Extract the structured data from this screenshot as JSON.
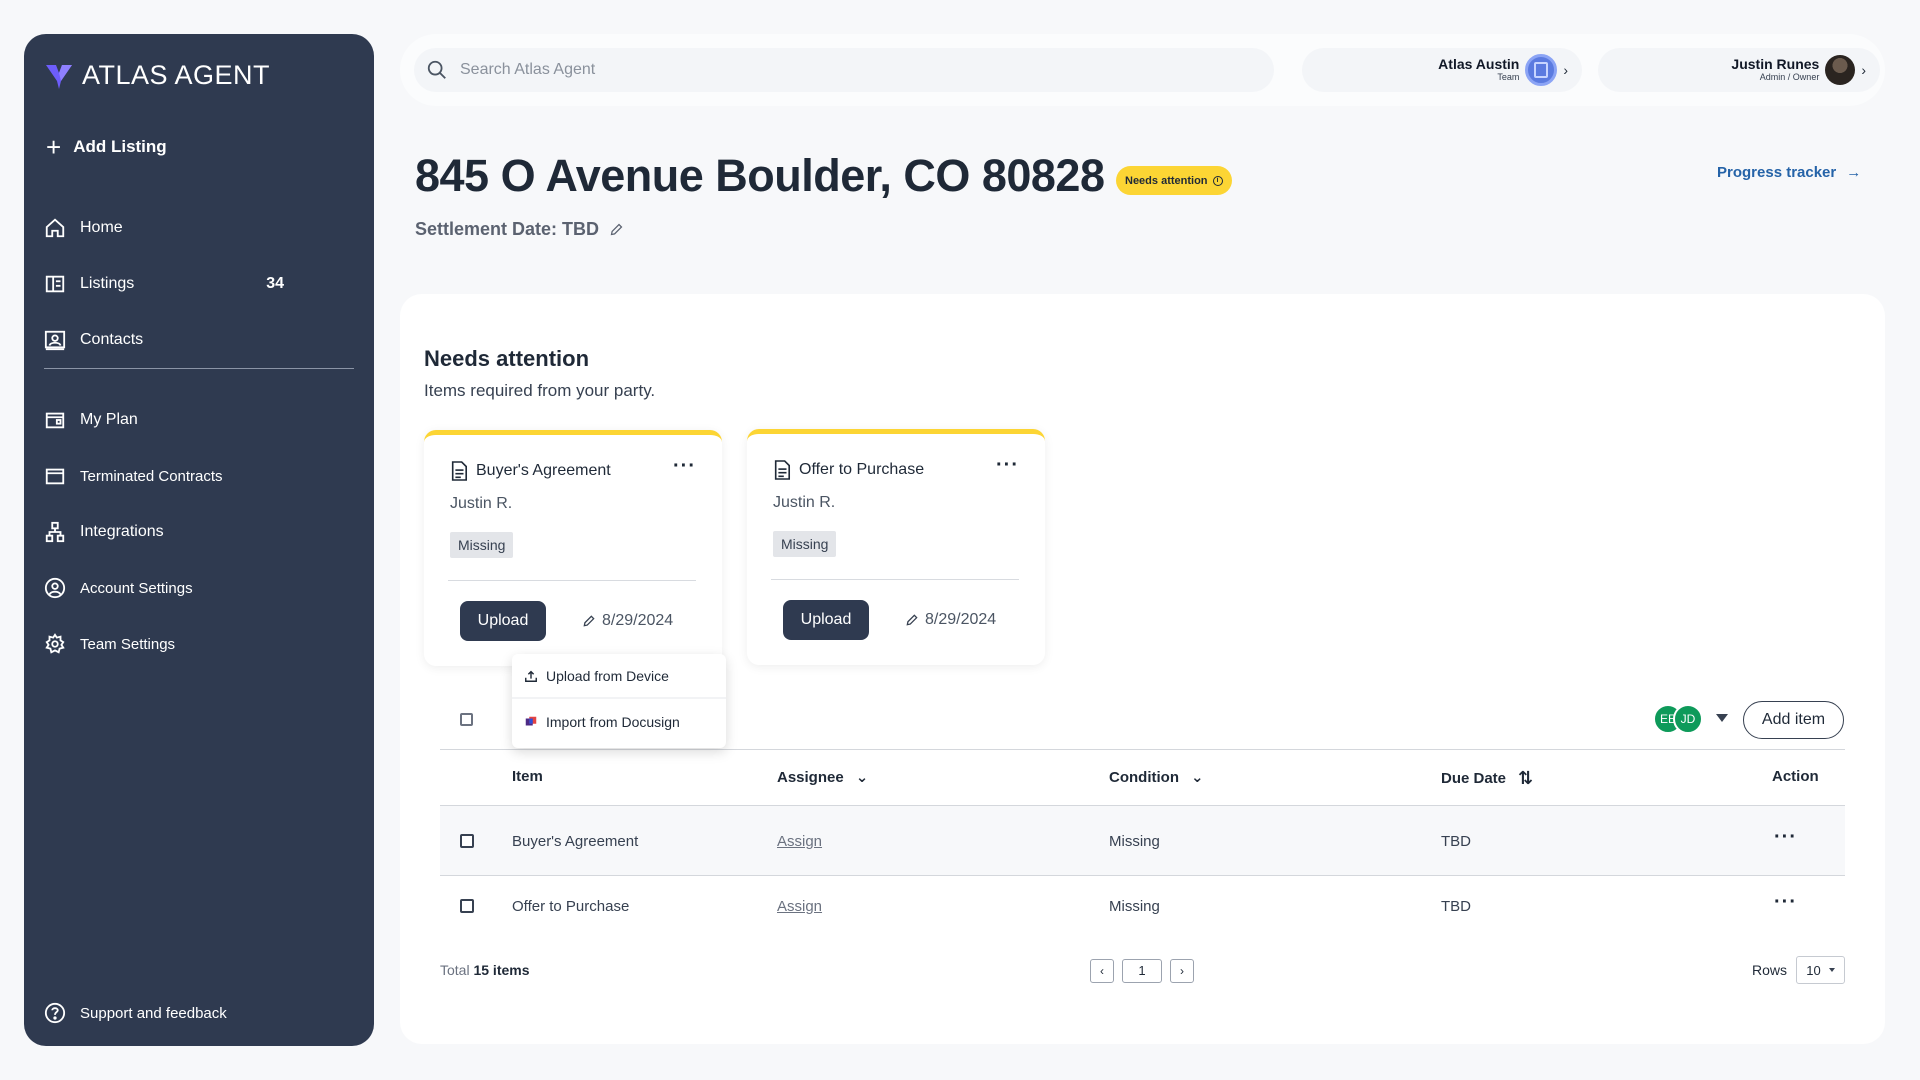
{
  "sidebar": {
    "logo": "ATLAS AGENT",
    "add_listing": "Add Listing",
    "items": [
      {
        "label": "Home",
        "icon": "home-icon"
      },
      {
        "label": "Listings",
        "icon": "listings-icon",
        "count": "34"
      },
      {
        "label": "Contacts",
        "icon": "contacts-icon"
      },
      {
        "label": "My Plan",
        "icon": "plan-icon"
      },
      {
        "label": "Terminated Contracts",
        "icon": "terminated-contracts-icon"
      },
      {
        "label": "Integrations",
        "icon": "integrations-icon"
      },
      {
        "label": "Account Settings",
        "icon": "account-settings-icon"
      },
      {
        "label": "Team Settings",
        "icon": "team-settings-icon"
      }
    ],
    "support": "Support and feedback"
  },
  "topbar": {
    "search_placeholder": "Search Atlas Agent",
    "team_account": {
      "name": "Atlas Austin",
      "role": "Team"
    },
    "user_account": {
      "name": "Justin Runes",
      "role": "Admin / Owner"
    }
  },
  "header": {
    "title": "845 O Avenue Boulder, CO 80828",
    "badge": "Needs attention",
    "settlement": "Settlement Date: TBD",
    "progress_link": "Progress tracker"
  },
  "section": {
    "title": "Needs attention",
    "subtitle": "Items required from your party."
  },
  "cards": [
    {
      "title": "Buyer's Agreement",
      "assignee": "Justin R.",
      "status": "Missing",
      "upload_label": "Upload",
      "date": "8/29/2024"
    },
    {
      "title": "Offer to Purchase",
      "assignee": "Justin R.",
      "status": "Missing",
      "upload_label": "Upload",
      "date": "8/29/2024"
    }
  ],
  "upload_menu": {
    "device": "Upload from Device",
    "docusign": "Import from Docusign"
  },
  "table": {
    "avatars": [
      "EE",
      "JD"
    ],
    "add_item": "Add item",
    "columns": [
      "Item",
      "Assignee",
      "Condition",
      "Due Date",
      "Action"
    ],
    "rows": [
      {
        "item": "Buyer's Agreement",
        "assignee": "Assign",
        "condition": "Missing",
        "due": "TBD"
      },
      {
        "item": "Offer to Purchase",
        "assignee": "Assign",
        "condition": "Missing",
        "due": "TBD"
      }
    ],
    "total_label": "Total",
    "total_count": "15 items",
    "page": "1",
    "rows_label": "Rows",
    "rows_value": "10"
  },
  "colors": {
    "sidebar_bg": "#2f3a50",
    "accent_yellow": "#fcd534",
    "link_blue": "#2563a8",
    "avatar_green": "#0e9a5a"
  }
}
